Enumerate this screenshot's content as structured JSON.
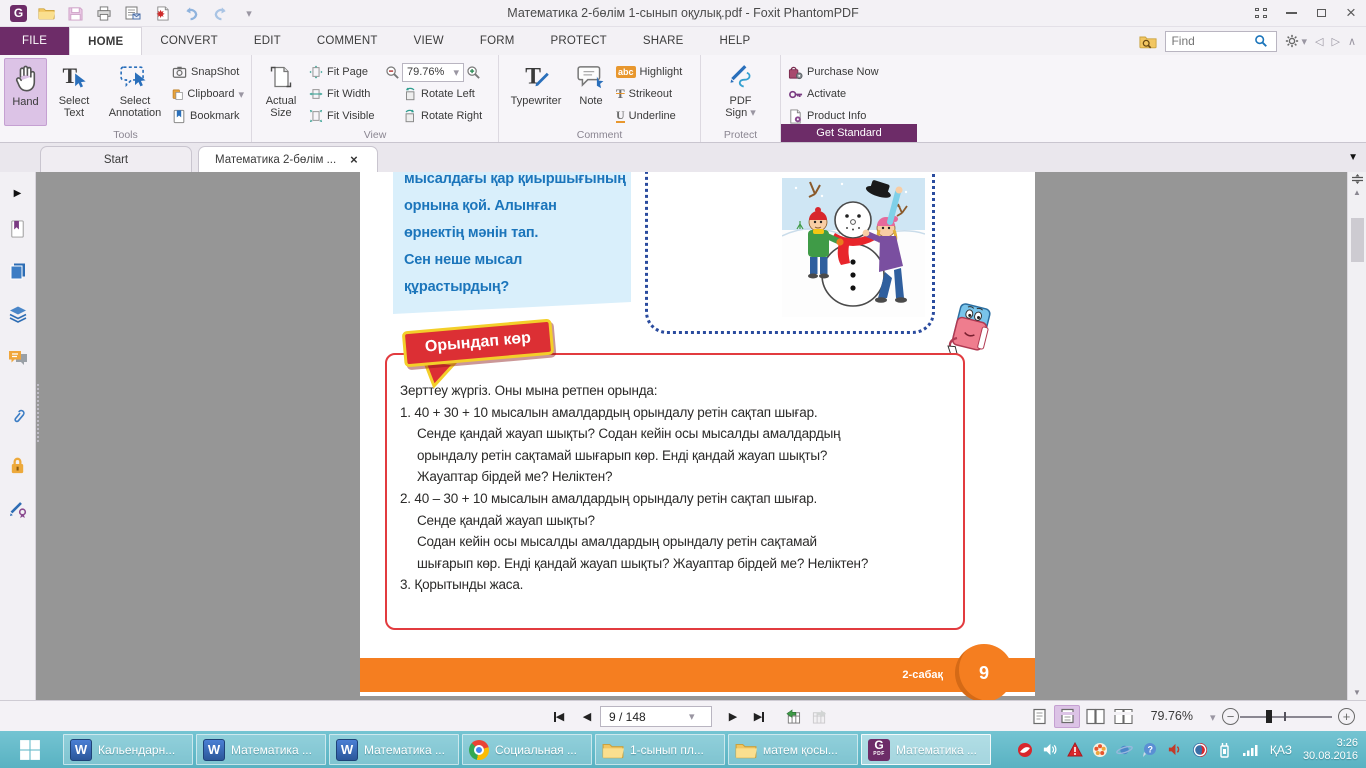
{
  "window": {
    "title": "Математика 2-бөлім 1-сынып оқулық.pdf - Foxit PhantomPDF"
  },
  "ribbon_tabs": [
    "FILE",
    "HOME",
    "CONVERT",
    "EDIT",
    "COMMENT",
    "VIEW",
    "FORM",
    "PROTECT",
    "SHARE",
    "HELP"
  ],
  "search": {
    "placeholder": "Find"
  },
  "toolbar": {
    "hand": "Hand",
    "select_text": "Select Text",
    "select_annotation": "Select Annotation",
    "snapshot": "SnapShot",
    "clipboard": "Clipboard",
    "bookmark": "Bookmark",
    "tools_group": "Tools",
    "actual_size_1": "Actual",
    "actual_size_2": "Size",
    "fit_page": "Fit Page",
    "fit_width": "Fit Width",
    "fit_visible": "Fit Visible",
    "zoom_value": "79.76%",
    "rotate_left": "Rotate Left",
    "rotate_right": "Rotate Right",
    "view_group": "View",
    "typewriter": "Typewriter",
    "note": "Note",
    "highlight": "Highlight",
    "strikeout": "Strikeout",
    "underline": "Underline",
    "comment_group": "Comment",
    "pdf_sign_1": "PDF",
    "pdf_sign_2": "Sign",
    "protect_group": "Protect",
    "purchase_now": "Purchase Now",
    "activate": "Activate",
    "product_info": "Product Info",
    "get_standard": "Get Standard"
  },
  "doc_tabs": {
    "start": "Start",
    "document": "Математика 2-бөлім ..."
  },
  "page": {
    "blue_text": [
      "мысалдағы қар қиыршығының",
      "орнына қой. Алынған",
      "өрнектің мәнін тап.",
      "Сен неше мысал",
      "құрастырдың?"
    ],
    "badge": "Орындап көр",
    "lines": [
      "Зерттеу жүргіз. Оны мына ретпен орында:",
      "1. 40 + 30 + 10 мысалын амалдардың орындалу ретін сақтап шығар.",
      "Сенде қандай жауап шықты? Содан кейін осы мысалды амалдардың",
      "орындалу ретін сақтамай шығарып көр. Енді қандай жауап шықты?",
      "Жауаптар бірдей ме? Неліктен?",
      "2. 40 – 30 + 10 мысалын амалдардың орындалу ретін сақтап шығар.",
      "Сенде қандай жауап шықты?",
      "Содан кейін осы мысалды амалдардың орындалу ретін сақтамай",
      "шығарып көр. Енді қандай жауап шықты? Жауаптар бірдей ме? Неліктен?",
      "3. Қорытынды жаса."
    ],
    "lesson_label": "2-сабақ",
    "page_number": "9"
  },
  "statusbar": {
    "page_field": "9 / 148",
    "zoom_value": "79.76%"
  },
  "taskbar": {
    "apps": [
      {
        "label": "Кальендарн...",
        "icon": "word"
      },
      {
        "label": "Математика ...",
        "icon": "word"
      },
      {
        "label": "Математика ...",
        "icon": "word"
      },
      {
        "label": "Социальная ...",
        "icon": "chrome"
      },
      {
        "label": "1-сынып пл...",
        "icon": "folder"
      },
      {
        "label": "матем қосы...",
        "icon": "folder"
      },
      {
        "label": "Математика ...",
        "icon": "foxit"
      }
    ],
    "lang": "ҚАЗ",
    "time": "3:26",
    "date": "30.08.2016"
  },
  "icons": {
    "caret_down": "▾",
    "menu_down": "▼",
    "chevron_up": "∧",
    "arrow_left": "◁",
    "arrow_right": "▷",
    "nav_prev": "◀",
    "nav_next": "▶",
    "scroll_up": "▲",
    "scroll_down": "▼",
    "close": "×",
    "expand_arrow": "▶",
    "minus": "−",
    "plus": "+",
    "logo_letter": "G",
    "word_letter": "W",
    "pdf_label": "PDF",
    "typewriter_letter": "T",
    "strikeout_letter": "T",
    "underline_letter": "U",
    "highlight_abc": "abc"
  },
  "colors": {
    "accent_purple": "#6d2c68",
    "taskbar_teal": "#59b2c2",
    "page_orange": "#f57e20",
    "box_red": "#e23b3f",
    "text_blue": "#1b75bb"
  }
}
